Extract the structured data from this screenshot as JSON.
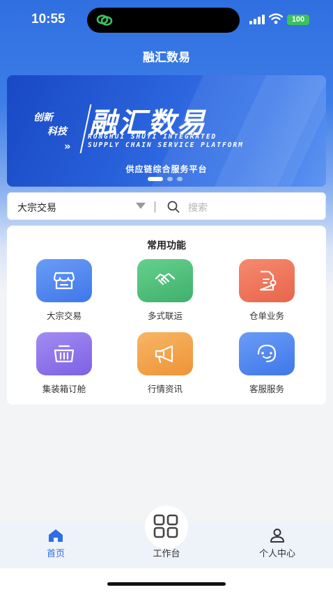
{
  "status_bar": {
    "time": "10:55",
    "battery": "100"
  },
  "header": {
    "title": "融汇数易"
  },
  "banner": {
    "tag_line1": "创新",
    "tag_line2": "科技",
    "arrows": "»",
    "brand": "融汇数易",
    "english_line1": "RONGHUI SHUYI INTEGRATED",
    "english_line2": "SUPPLY CHAIN SERVICE PLATFORM",
    "subtitle": "供应链综合服务平台",
    "slide_count": 3,
    "active_slide": 1
  },
  "search": {
    "category": "大宗交易",
    "placeholder": "搜索"
  },
  "functions": {
    "title": "常用功能",
    "items": [
      {
        "label": "大宗交易",
        "icon": "store-icon",
        "color": "#4f86f0"
      },
      {
        "label": "多式联运",
        "icon": "handshake-icon",
        "color": "#4fc07c"
      },
      {
        "label": "仓单业务",
        "icon": "document-gear-icon",
        "color": "#ef7559"
      },
      {
        "label": "集装箱订舱",
        "icon": "basket-icon",
        "color": "#8d73ea"
      },
      {
        "label": "行情资讯",
        "icon": "megaphone-icon",
        "color": "#f2a24a"
      },
      {
        "label": "客服服务",
        "icon": "headset-icon",
        "color": "#4f86f0"
      }
    ]
  },
  "tabbar": {
    "items": [
      {
        "label": "首页",
        "icon": "home-icon",
        "active": true
      },
      {
        "label": "工作台",
        "icon": "grid-icon",
        "active": false
      },
      {
        "label": "个人中心",
        "icon": "user-icon",
        "active": false
      }
    ],
    "active_color": "#2f6fe0",
    "inactive_color": "#333333"
  }
}
